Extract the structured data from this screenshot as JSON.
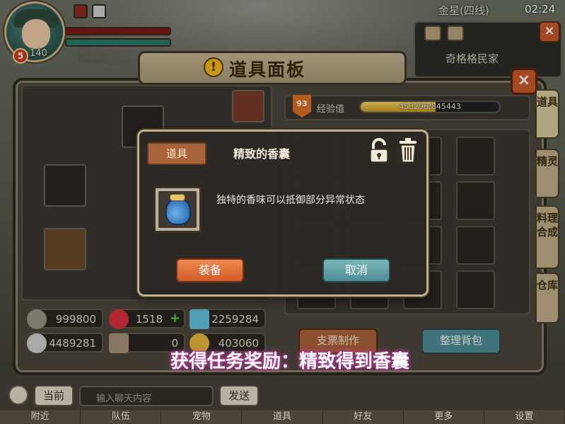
{
  "hud": {
    "level": "5",
    "level_value": "140",
    "server": "金星(四线)",
    "time": "02:24",
    "location": "奇格格民家"
  },
  "window": {
    "title": "道具面板",
    "close_label": "×"
  },
  "side_tabs": [
    "道具",
    "精灵",
    "料理合成",
    "仓库"
  ],
  "experience": {
    "level": "93",
    "label": "经验值",
    "value": "453296/845443",
    "fill_fraction": 0.54
  },
  "currencies": {
    "stars": "999800",
    "hearts": "1518",
    "gems": "2259284",
    "coins_a": "4489281",
    "axes": "0",
    "gold": "403060"
  },
  "buttons": {
    "craft": "支票制作",
    "sort": "整理背包"
  },
  "dialog": {
    "tag": "道具",
    "item_name": "精致的香囊",
    "description": "独特的香味可以抵御部分异常状态",
    "equip": "装备",
    "cancel": "取消"
  },
  "notice": "获得任务奖励：精致得到香囊",
  "chat": {
    "current_label": "当前",
    "placeholder": "输入聊天内容",
    "send": "发送"
  },
  "nav": [
    "附近",
    "队伍",
    "宠物",
    "道具",
    "好友",
    "更多",
    "设置"
  ],
  "colors": {
    "accent_orange": "#cf5a2a",
    "accent_teal": "#4f8e95",
    "notice_glow": "#c83fa8"
  }
}
